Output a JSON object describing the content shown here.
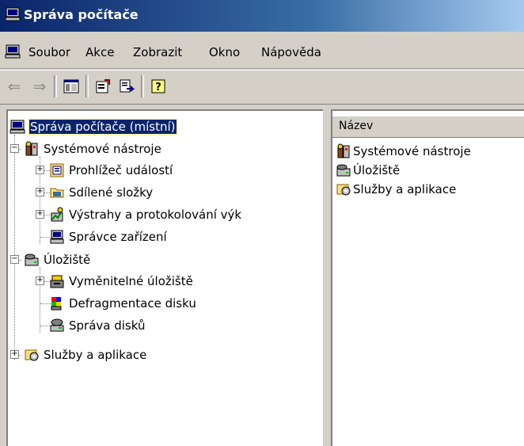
{
  "window": {
    "title": "Správa počítače",
    "icon": "computer-management-icon"
  },
  "menu": [
    {
      "label": "Soubor"
    },
    {
      "label": "Akce"
    },
    {
      "label": "Zobrazit"
    },
    {
      "label": "Okno"
    },
    {
      "label": "Nápověda"
    }
  ],
  "toolbar": {
    "icons": [
      "back-arrow-icon",
      "forward-arrow-icon",
      "show-hide-tree-icon",
      "properties-icon",
      "export-list-icon",
      "help-icon"
    ]
  },
  "tree": {
    "root": "Správa počítače (místní)",
    "system_tools": "Systémové nástroje",
    "event_viewer": "Prohlížeč událostí",
    "shared_folders": "Sdílené složky",
    "alerts_logs": "Výstrahy a protokolování výk",
    "device_manager": "Správce zařízení",
    "storage": "Úložiště",
    "removable_storage": "Vyměnitelné úložiště",
    "defrag": "Defragmentace disku",
    "disk_management": "Správa disků",
    "services_apps": "Služby a aplikace"
  },
  "list": {
    "column_header": "Název",
    "items": [
      {
        "label": "Systémové nástroje",
        "icon": "system-tools-icon"
      },
      {
        "label": "Úložiště",
        "icon": "storage-icon"
      },
      {
        "label": "Služby a aplikace",
        "icon": "services-apps-icon"
      }
    ]
  },
  "colors": {
    "title_start": "#0a246a",
    "title_end": "#a6caf0",
    "selection": "#0a246a",
    "face": "#d4d0c8"
  }
}
